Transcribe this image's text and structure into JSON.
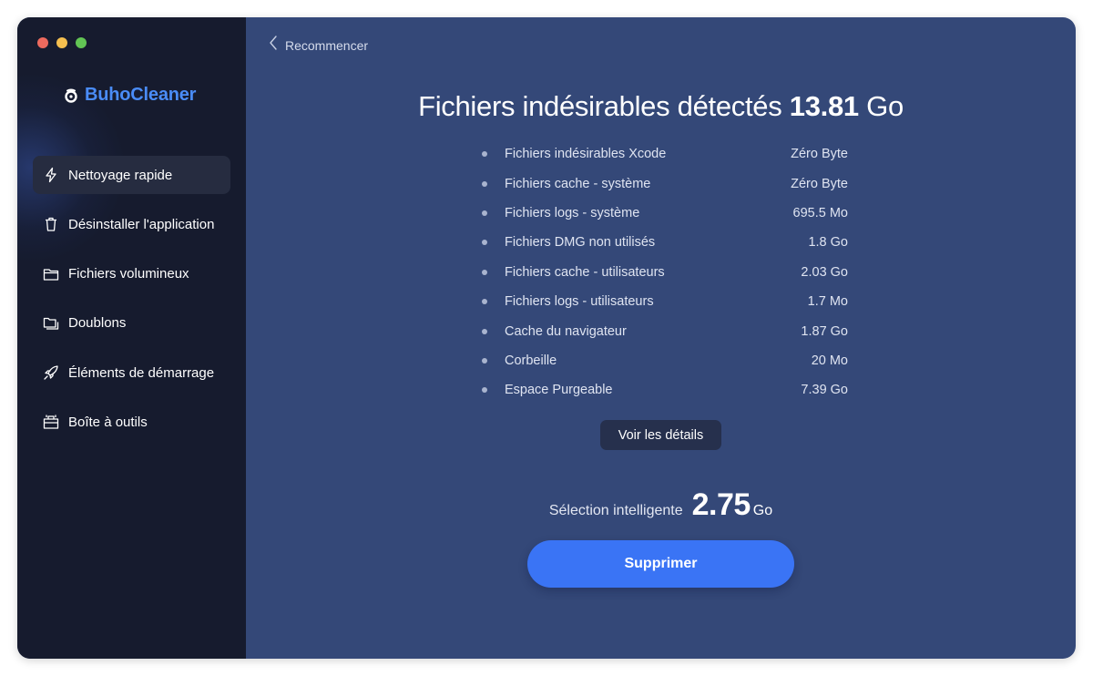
{
  "app": {
    "name": "BuhoCleaner"
  },
  "sidebar": {
    "items": [
      {
        "label": "Nettoyage rapide",
        "icon": "lightning-icon",
        "active": true
      },
      {
        "label": "Désinstaller l'application",
        "icon": "trash-icon"
      },
      {
        "label": "Fichiers volumineux",
        "icon": "folder-icon"
      },
      {
        "label": "Doublons",
        "icon": "duplicate-folder-icon"
      },
      {
        "label": "Éléments de démarrage",
        "icon": "rocket-icon"
      },
      {
        "label": "Boîte à outils",
        "icon": "toolbox-icon"
      }
    ]
  },
  "toolbar": {
    "back_label": "Recommencer"
  },
  "summary": {
    "title_text": "Fichiers indésirables détectés",
    "total_value": "13.81",
    "total_unit": "Go",
    "items": [
      {
        "label": "Fichiers indésirables Xcode",
        "value": "Zéro Byte"
      },
      {
        "label": "Fichiers cache - système",
        "value": "Zéro Byte"
      },
      {
        "label": "Fichiers logs - système",
        "value": "695.5 Mo"
      },
      {
        "label": "Fichiers DMG non utilisés",
        "value": "1.8 Go"
      },
      {
        "label": "Fichiers cache - utilisateurs",
        "value": "2.03 Go"
      },
      {
        "label": "Fichiers logs - utilisateurs",
        "value": "1.7 Mo"
      },
      {
        "label": "Cache du navigateur",
        "value": "1.87 Go"
      },
      {
        "label": "Corbeille",
        "value": "20 Mo"
      },
      {
        "label": "Espace Purgeable",
        "value": "7.39 Go"
      }
    ],
    "details_label": "Voir les détails"
  },
  "selection": {
    "label": "Sélection intelligente",
    "value": "2.75",
    "unit": "Go"
  },
  "actions": {
    "delete_label": "Supprimer"
  },
  "colors": {
    "sidebar_bg": "#161b2e",
    "main_bg": "#344878",
    "brand": "#4a8cf7",
    "primary_button": "#3a74f5"
  }
}
